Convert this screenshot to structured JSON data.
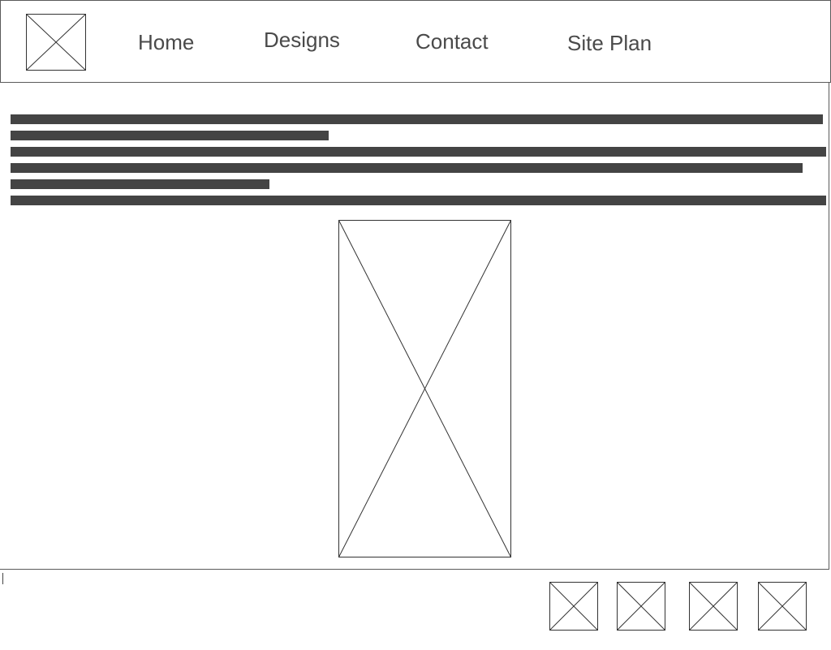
{
  "header": {
    "logo_icon": "image-placeholder-icon",
    "nav": [
      {
        "label": "Home"
      },
      {
        "label": "Designs"
      },
      {
        "label": "Contact"
      },
      {
        "label": "Site Plan"
      }
    ]
  },
  "content": {
    "text_lines": 6,
    "hero_image_icon": "image-placeholder-icon"
  },
  "footer": {
    "social_icons": [
      "image-placeholder-icon",
      "image-placeholder-icon",
      "image-placeholder-icon",
      "image-placeholder-icon"
    ]
  },
  "colors": {
    "border": "#5a5a5a",
    "text_bar": "#444444",
    "nav_text": "#4a4a4a",
    "background": "#ffffff"
  }
}
